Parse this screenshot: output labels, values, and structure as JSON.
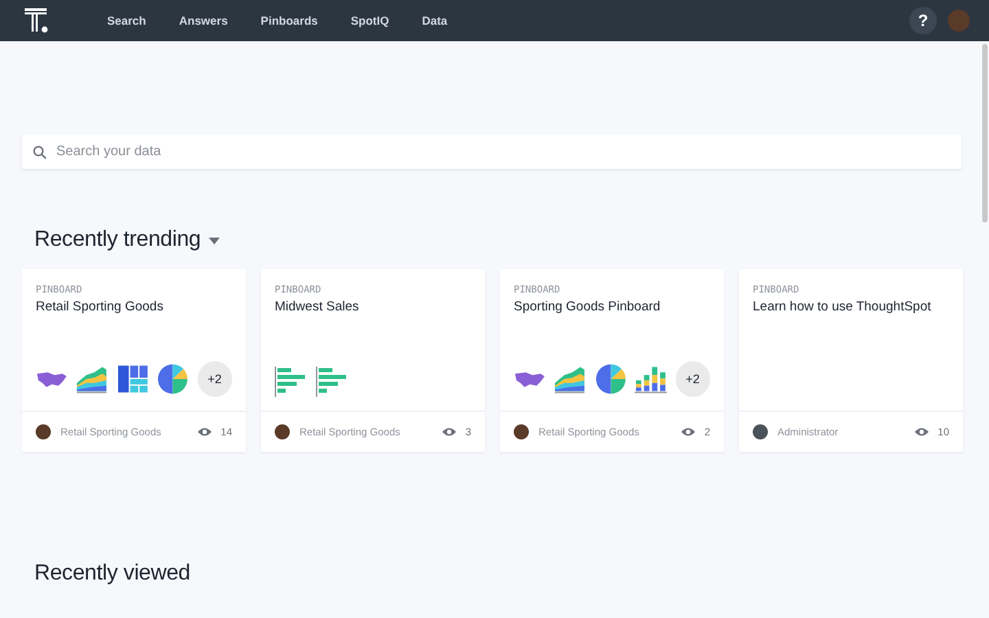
{
  "nav": {
    "items": [
      {
        "label": "Search",
        "selected": false
      },
      {
        "label": "Answers",
        "selected": false
      },
      {
        "label": "Pinboards",
        "selected": false
      },
      {
        "label": "SpotIQ",
        "selected": false
      },
      {
        "label": "Data",
        "selected": false
      }
    ],
    "help": "?"
  },
  "search": {
    "placeholder": "Search your data"
  },
  "trending": {
    "title": "Recently trending",
    "cards": [
      {
        "type": "PINBOARD",
        "title": "Retail Sporting Goods",
        "thumbnails": [
          {
            "kind": "map"
          },
          {
            "kind": "area"
          },
          {
            "kind": "treemap"
          },
          {
            "kind": "pie"
          }
        ],
        "more": "+2",
        "owner": "Retail Sporting Goods",
        "views": "14"
      },
      {
        "type": "PINBOARD",
        "title": "Midwest Sales",
        "thumbnails": [
          {
            "kind": "hbar"
          },
          {
            "kind": "hbar"
          }
        ],
        "owner": "Retail Sporting Goods",
        "views": "3"
      },
      {
        "type": "PINBOARD",
        "title": "Sporting Goods Pinboard",
        "thumbnails": [
          {
            "kind": "map"
          },
          {
            "kind": "area"
          },
          {
            "kind": "pie"
          },
          {
            "kind": "column"
          }
        ],
        "more": "+2",
        "owner": "Retail Sporting Goods",
        "views": "2"
      },
      {
        "type": "PINBOARD",
        "title": "Learn how to use ThoughtSpot",
        "owner": "Administrator",
        "views": "10"
      }
    ]
  },
  "viewed": {
    "title": "Recently viewed"
  }
}
